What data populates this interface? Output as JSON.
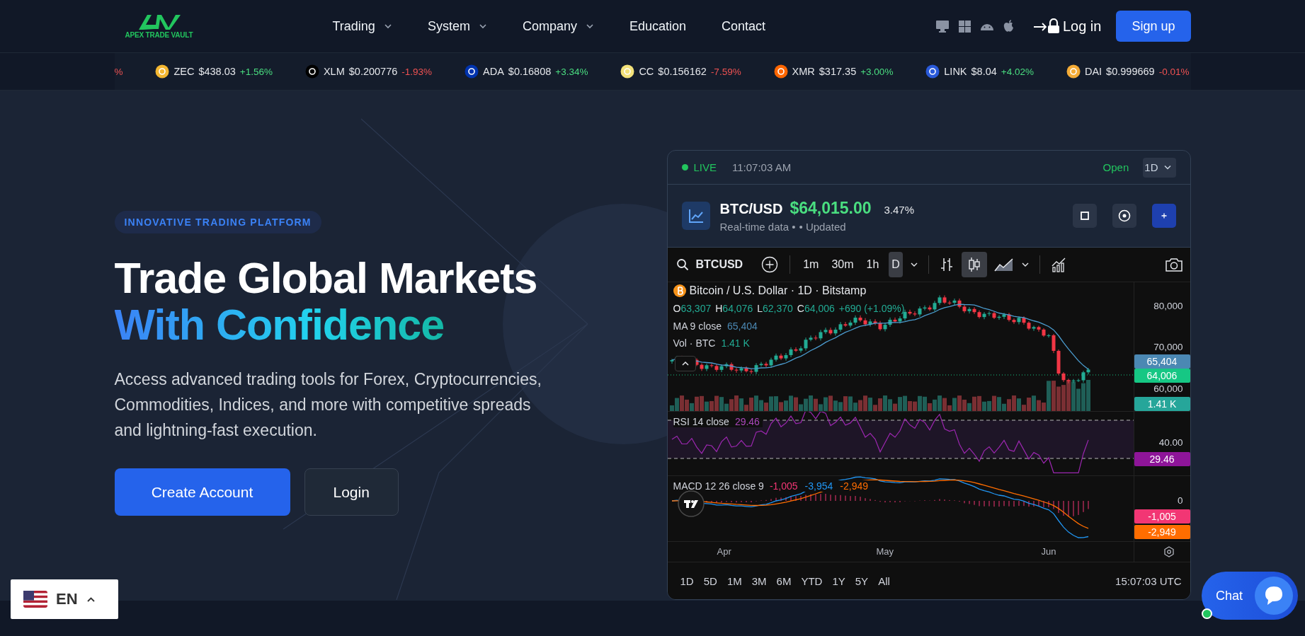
{
  "header": {
    "logo": "APEX TRADE VAULT",
    "nav": [
      {
        "label": "Trading",
        "dropdown": true
      },
      {
        "label": "System",
        "dropdown": true
      },
      {
        "label": "Company",
        "dropdown": true
      },
      {
        "label": "Education",
        "dropdown": false
      },
      {
        "label": "Contact",
        "dropdown": false
      }
    ],
    "login": "Log in",
    "signup": "Sign up"
  },
  "ticker": {
    "cut_change": "%",
    "items": [
      {
        "symbol": "ZEC",
        "price": "$438.03",
        "change": "+1.56%",
        "rising": true,
        "color": "#f4b731"
      },
      {
        "symbol": "XLM",
        "price": "$0.200776",
        "change": "-1.93%",
        "rising": false,
        "color": "#000000"
      },
      {
        "symbol": "ADA",
        "price": "$0.16808",
        "change": "+3.34%",
        "rising": true,
        "color": "#0033ad"
      },
      {
        "symbol": "CC",
        "price": "$0.156162",
        "change": "-7.59%",
        "rising": false,
        "color": "#f3e27a"
      },
      {
        "symbol": "XMR",
        "price": "$317.35",
        "change": "+3.00%",
        "rising": true,
        "color": "#ff6600"
      },
      {
        "symbol": "LINK",
        "price": "$8.04",
        "change": "+4.02%",
        "rising": true,
        "color": "#2a5ada"
      },
      {
        "symbol": "DAI",
        "price": "$0.999669",
        "change": "-0.01%",
        "rising": false,
        "color": "#f5ac37"
      }
    ]
  },
  "hero": {
    "badge": "INNOVATIVE TRADING PLATFORM",
    "title": "Trade Global Markets",
    "title_accent": "With Confidence",
    "description": "Access advanced trading tools for Forex, Cryptocurrencies, Commodities, Indices, and more with competitive spreads and lightning-fast execution.",
    "buttons": [
      {
        "label": "Create Account",
        "kind": "primary"
      },
      {
        "label": "Login",
        "kind": "secondary"
      }
    ]
  },
  "widget": {
    "live": "LIVE",
    "time": "11:07:03 AM",
    "market": "Open",
    "interval": "1D",
    "pair": "BTC/USD",
    "price": "$64,015.00",
    "change": "3.47%",
    "subtitle": "Real-time data •",
    "updated": "• Updated",
    "symbol": "BTCUSD",
    "intervals": [
      {
        "label": "1m",
        "selected": false
      },
      {
        "label": "30m",
        "selected": false
      },
      {
        "label": "1h",
        "selected": false
      },
      {
        "label": "D",
        "selected": true
      }
    ],
    "chart": {
      "title": "Bitcoin / U.S. Dollar · 1D · Bitstamp",
      "ohlc": [
        {
          "label": "O",
          "value": "63,307"
        },
        {
          "label": "H",
          "value": "64,076"
        },
        {
          "label": "L",
          "value": "62,370"
        },
        {
          "label": "C",
          "value": "64,006"
        }
      ],
      "ohlc_change": "+690 (+1.09%)",
      "ma": {
        "label": "MA 9 close",
        "value": "65,404"
      },
      "vol": {
        "label": "Vol · BTC",
        "value": "1.41 K"
      },
      "rsi": {
        "label": "RSI 14 close",
        "value": "29.46"
      },
      "macd": {
        "label": "MACD 12 26 close 9",
        "values": [
          {
            "text": "-1,005",
            "color": "#f23674"
          },
          {
            "text": "-3,954",
            "color": "#2196f3"
          },
          {
            "text": "-2,949",
            "color": "#ff6d00"
          }
        ]
      },
      "price_ticks": [
        "80,000",
        "70,000",
        "60,000"
      ],
      "rsi_tick": "40.00",
      "macd_tick": "0",
      "price_badges": [
        {
          "text": "65,404",
          "color": "#4b88b3"
        },
        {
          "text": "64,006",
          "color": "#16c784"
        },
        {
          "text": "1.41 K",
          "color": "#26a69a"
        }
      ],
      "rsi_badges": [
        {
          "text": "29.46",
          "color": "#8e1599"
        }
      ],
      "macd_badges": [
        {
          "text": "-1,005",
          "color": "#f23674"
        },
        {
          "text": "-2,949",
          "color": "#ff6d00"
        }
      ],
      "dates": [
        "Apr",
        "May",
        "Jun"
      ]
    },
    "ranges": [
      "1D",
      "5D",
      "1M",
      "3M",
      "6M",
      "YTD",
      "1Y",
      "5Y",
      "All"
    ],
    "utc": "15:07:03 UTC"
  },
  "language": {
    "code": "EN"
  },
  "chat": {
    "label": "Chat",
    "online": true
  }
}
